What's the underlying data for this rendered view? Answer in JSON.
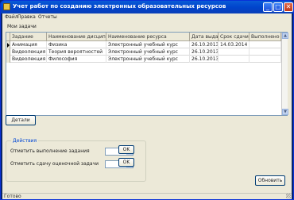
{
  "window": {
    "title": "Учет работ по созданию электронных образовательных ресурсов",
    "controls": {
      "minimize": "_",
      "maximize": "□",
      "close": "✕"
    }
  },
  "menu": {
    "items": [
      "Файл",
      "Правка",
      "Отчеты"
    ]
  },
  "section_title": "Мои задачи",
  "table": {
    "columns": [
      "Задание",
      "Наименование дисциплины",
      "Наименование ресурса",
      "Дата выдачи",
      "Срок сдачи",
      "Выполнено"
    ],
    "rows": [
      [
        "Анимация",
        "Физика",
        "Электронный учебный курс",
        "26.10.2013",
        "14.03.2014",
        ""
      ],
      [
        "Видеолекция",
        "Теория вероятностей",
        "Электронный учебный курс",
        "26.10.2013",
        "",
        ""
      ],
      [
        "Видеолекция",
        "Философия",
        "Электронный учебный курс",
        "26.10.2013",
        "",
        ""
      ]
    ]
  },
  "buttons": {
    "details": "Детали",
    "ok1": "OK",
    "ok2": "OK",
    "refresh": "Обновить"
  },
  "groupbox": {
    "title": "Действия",
    "label1": "Отметить выполнение задания",
    "label2": "Отметить сдачу оценочной задачи"
  },
  "status": {
    "text": "Готово"
  }
}
